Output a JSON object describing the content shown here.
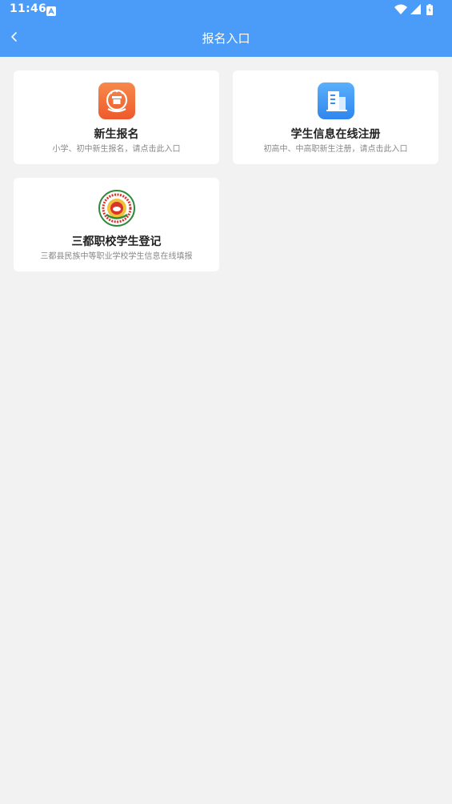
{
  "status_bar": {
    "time": "11:46"
  },
  "header": {
    "title": "报名入口",
    "background": "#4a9cf8"
  },
  "cards": [
    {
      "title": "新生报名",
      "description": "小学、初中新生报名，请点击此入口",
      "icon": "emblem-icon",
      "icon_color": "#f26b3a"
    },
    {
      "title": "学生信息在线注册",
      "description": "初高中、中高职新生注册，请点击此入口",
      "icon": "building-icon",
      "icon_color": "#3b8ff0"
    },
    {
      "title": "三都职校学生登记",
      "description": "三都县民族中等职业学校学生信息在线填报",
      "icon": "school-seal-icon",
      "icon_color": "#2e8b3a"
    }
  ]
}
